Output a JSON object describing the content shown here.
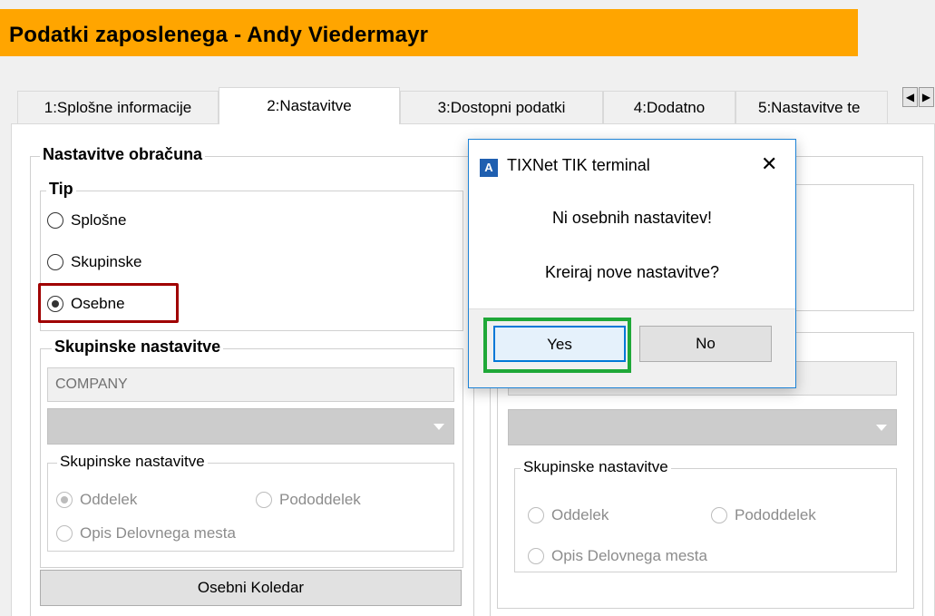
{
  "window": {
    "title": "Podatki zaposlenega - Andy Viedermayr"
  },
  "tabs": [
    {
      "label": "1:Splošne informacije"
    },
    {
      "label": "2:Nastavitve"
    },
    {
      "label": "3:Dostopni podatki"
    },
    {
      "label": "4:Dodatno"
    },
    {
      "label": "5:Nastavitve te"
    }
  ],
  "left": {
    "group_title": "Nastavitve obračuna",
    "tip": {
      "title": "Tip",
      "options": [
        {
          "label": "Splošne",
          "checked": false
        },
        {
          "label": "Skupinske",
          "checked": false
        },
        {
          "label": "Osebne",
          "checked": true
        }
      ]
    },
    "skupinske": {
      "title": "Skupinske nastavitve",
      "company_value": "COMPANY",
      "combo_value": "",
      "inner_title": "Skupinske nastavitve",
      "oddelek": "Oddelek",
      "pododdelek": "Pododdelek",
      "opis": "Opis Delovnega mesta"
    },
    "osebni_koledar": "Osebni Koledar"
  },
  "right": {
    "inner_title": "Skupinske nastavitve",
    "oddelek": "Oddelek",
    "pododdelek": "Pododdelek",
    "opis": "Opis Delovnega mesta"
  },
  "dialog": {
    "icon_letter": "A",
    "title": "TIXNet TIK terminal",
    "line1": "Ni osebnih nastavitev!",
    "line2": "Kreiraj nove nastavitve?",
    "yes": "Yes",
    "no": "No",
    "close": "✕"
  },
  "icons": {
    "tab_left": "◀",
    "tab_right": "▶"
  },
  "colors": {
    "title_bg": "#ffa500",
    "highlight_red": "#a00000",
    "highlight_green": "#1fa838",
    "dialog_border": "#1e83d6"
  }
}
